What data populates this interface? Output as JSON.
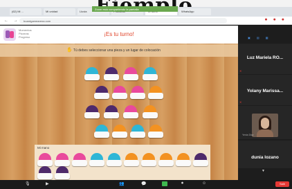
{
  "overlay_title": "Ejemplo",
  "browser": {
    "tabs": [
      {
        "label": "(62) Mi ...",
        "active": false
      },
      {
        "label": "Mi unidad",
        "active": false
      },
      {
        "label": "Lluvia",
        "active": false
      },
      {
        "label": "Protocolo",
        "active": false
      },
      {
        "label": "Tu turno",
        "active": true
      },
      {
        "label": "WhatsApp",
        "active": false
      }
    ],
    "share_banner": "Zoom está compartiendo la pantalla",
    "url": "boardgamearena.com"
  },
  "game": {
    "player_info": [
      "Momentos",
      "Pizarras",
      "Progreso"
    ],
    "turn_title": "¡Es tu turno!",
    "instruction": "Tú debes seleccionar una pieza y un lugar de colocación",
    "hand_label": "Mi mano",
    "colors": {
      "pink": "#e94a9c",
      "purple": "#4e2a6b",
      "cyan": "#2fb6d6",
      "orange": "#f39221"
    }
  },
  "zoom": {
    "participants": [
      {
        "name": "Luz Mariela RO...",
        "sub": ""
      },
      {
        "name": "Yolany Marissa...",
        "sub": ""
      },
      {
        "name": "dunia lozano",
        "sub": "Yenia Diaz"
      }
    ],
    "end_label": "Salir"
  }
}
